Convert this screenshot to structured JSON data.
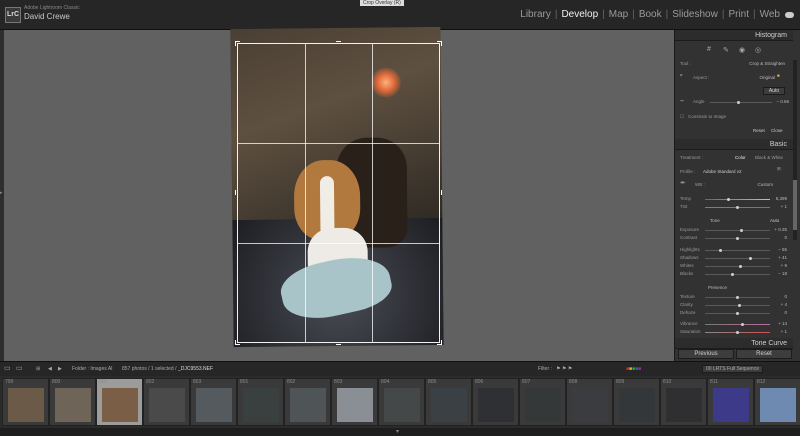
{
  "app": {
    "name": "Adobe Lightroom Classic",
    "user": "David Crewe",
    "logo": "LrC",
    "tooltip": "Crop Overlay (R)"
  },
  "modules": [
    "Library",
    "Develop",
    "Map",
    "Book",
    "Slideshow",
    "Print",
    "Web"
  ],
  "active_module": "Develop",
  "panel": {
    "histogram": "Histogram",
    "crop": {
      "tool": "Tool :",
      "tool_name": "Crop & Straighten",
      "aspect_label": "Aspect :",
      "aspect_value": "Original",
      "auto": "Auto",
      "angle_label": "Angle",
      "angle_value": "− 0.66",
      "constrain": "Constrain to Image",
      "reset": "Reset",
      "close": "Close"
    },
    "basic": {
      "title": "Basic",
      "treatment_label": "Treatment :",
      "color": "Color",
      "bw": "Black & White",
      "profile_label": "Profile :",
      "profile_value": "Adobe Standard v2",
      "wb_label": "WB :",
      "wb_value": "Custom",
      "temp_label": "Temp",
      "temp_value": "5,399",
      "tint_label": "Tint",
      "tint_value": "+ 1",
      "tone": "Tone",
      "tone_auto": "Auto",
      "exposure_label": "Exposure",
      "exposure_value": "+ 0.35",
      "contrast_label": "Contrast",
      "contrast_value": "0",
      "highlights_label": "Highlights",
      "highlights_value": "− 55",
      "shadows_label": "Shadows",
      "shadows_value": "+ 41",
      "whites_label": "Whites",
      "whites_value": "+ 9",
      "blacks_label": "Blacks",
      "blacks_value": "− 18",
      "presence": "Presence",
      "texture_label": "Texture",
      "texture_value": "0",
      "clarity_label": "Clarity",
      "clarity_value": "+ 4",
      "dehaze_label": "Dehaze",
      "dehaze_value": "0",
      "vibrance_label": "Vibrance",
      "vibrance_value": "+ 14",
      "saturation_label": "Saturation",
      "saturation_value": "+ 1"
    },
    "tone_curve": "Tone Curve",
    "previous": "Previous",
    "reset": "Reset"
  },
  "filmbar": {
    "folder": "Folder : Images AI",
    "count": "857 photos / 1 selected /",
    "filename": "_DJC9553.NEF",
    "filter": "Filter :",
    "preset": "00 LRTS Full Sequence"
  },
  "thumbnails": [
    {
      "num": "799",
      "color": "#6b5a47"
    },
    {
      "num": "800",
      "color": "#6f6458"
    },
    {
      "num": "801",
      "color": "#7a5f46",
      "selected": true
    },
    {
      "num": "802",
      "color": "#4a4a4a"
    },
    {
      "num": "803",
      "color": "#555a5e"
    },
    {
      "num": "801",
      "color": "#3a3f3f"
    },
    {
      "num": "802",
      "color": "#4f5456"
    },
    {
      "num": "803",
      "color": "#8a8f96"
    },
    {
      "num": "804",
      "color": "#444848"
    },
    {
      "num": "805",
      "color": "#3b4045"
    },
    {
      "num": "806",
      "color": "#2e3033"
    },
    {
      "num": "807",
      "color": "#353838"
    },
    {
      "num": "808",
      "color": "#3a3c3f"
    },
    {
      "num": "809",
      "color": "#34373a"
    },
    {
      "num": "810",
      "color": "#2f2f31"
    },
    {
      "num": "811",
      "color": "#3d3a8a"
    },
    {
      "num": "812",
      "color": "#6f8ab0"
    }
  ]
}
